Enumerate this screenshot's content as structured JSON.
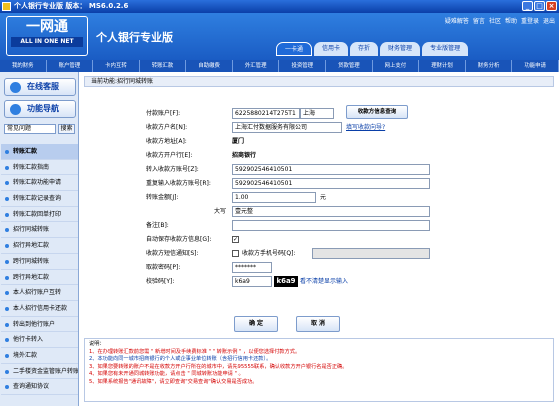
{
  "window": {
    "title": "个人银行专业版  版本： MS6.0.2.6"
  },
  "header": {
    "logo_cn": "一网通",
    "logo_en": "ALL IN ONE NET",
    "brand": "个人银行专业版",
    "toplinks": [
      "疑难解答",
      "留言",
      "社区",
      "帮助",
      "重登录",
      "退出"
    ],
    "tabs": [
      {
        "label": "一卡通",
        "active": true
      },
      {
        "label": "信用卡",
        "active": false
      },
      {
        "label": "存折",
        "active": false
      },
      {
        "label": "财务管理",
        "active": false
      },
      {
        "label": "专业版管理",
        "active": false
      }
    ]
  },
  "menubar": [
    "我的财务",
    "账户管理",
    "卡内互转",
    "转账汇款",
    "自助缴费",
    "外汇管理",
    "投资管理",
    "贷款管理",
    "网上支付",
    "理财计划",
    "财务分析",
    "功能申请"
  ],
  "sidebar": {
    "online_service": "在线客服",
    "func_nav": "功能导航",
    "search_placeholder": "常见问题",
    "search_btn": "搜索",
    "items": [
      {
        "label": "转账汇款",
        "head": true
      },
      {
        "label": "转账汇款指南",
        "head": false
      },
      {
        "label": "转账汇款功能申请",
        "head": false
      },
      {
        "label": "转账汇款记录查询",
        "head": false
      },
      {
        "label": "转账汇款回单打印",
        "head": false
      },
      {
        "label": "招行同城转账",
        "head": false
      },
      {
        "label": "招行异地汇款",
        "head": false
      },
      {
        "label": "跨行同城转账",
        "head": false
      },
      {
        "label": "跨行异地汇款",
        "head": false
      },
      {
        "label": "本人招行账户互转",
        "head": false
      },
      {
        "label": "本人招行信用卡还款",
        "head": false
      },
      {
        "label": "转出到他行账户",
        "head": false
      },
      {
        "label": "他行卡转入",
        "head": false
      },
      {
        "label": "境外汇款",
        "head": false
      },
      {
        "label": "二手楼资金监管账户转账",
        "head": false
      },
      {
        "label": "查询通知协议",
        "head": false
      }
    ]
  },
  "main": {
    "breadcrumb": "当前功能:招行同城转账",
    "form": {
      "pay_account_label": "付款账户[F]:",
      "pay_account_value": "6225880214T275T1",
      "pay_city": "上海",
      "payee_query_btn": "收款方信息查询",
      "payee_name_label": "收款方户名[N]:",
      "payee_name_value": "上海汇付数据服务有限公司",
      "help_link": "填写收款向导?",
      "payee_addr_label": "收款方地址[A]:",
      "payee_addr_value": "厦门",
      "payee_bank_label": "收款方开户行[E]:",
      "payee_bank_value": "招商银行",
      "acct_label": "转入收款方账号[Z]:",
      "acct_value": "592902546410501",
      "acct_repeat_label": "重复输入收款方账号[R]:",
      "acct_repeat_value": "592902546410501",
      "amount_label": "转账金额[J]:",
      "amount_value": "1.00",
      "amount_unit": "元",
      "capital_label": "大写",
      "capital_value": "壹元整",
      "remark_label": "备注[B]:",
      "save_info_label": "自动保存收款方信息[G]:",
      "notify_label": "收款方短信通知[S]:",
      "notify_phone_label": "收款方手机号码[Q]:",
      "pin_label": "取款密码[P]:",
      "pin_value": "*******",
      "captcha_label": "校验码[Y]:",
      "captcha_input": "k6a9",
      "captcha_image": "k6a9",
      "captcha_hint": "看不清楚显示输入"
    },
    "confirm_btn": "确 定",
    "cancel_btn": "取 消",
    "notes": {
      "title": "说明：",
      "lines": [
        "1、在办理转账汇款前您需 \" 新增时间及手续费标准 \" \" 转账示例 \" ，以便您选择付款方式。",
        "2、本功能向同一城市招商银行的个人或企事业单位转账（含招行信用卡还款）。",
        "3、如果您要转账的账户不是在收款方开户行所在的城市中，请先95555联系，确认收款方开户银行名是否正确。",
        "4、如果您有未开通同城转账功能，请点击 \" 同城转账功能申请 \" 。",
        "5、如果系统报告\"通讯故障\"，请立即查询\"交易查询\"确认交易是否成功。"
      ]
    }
  }
}
